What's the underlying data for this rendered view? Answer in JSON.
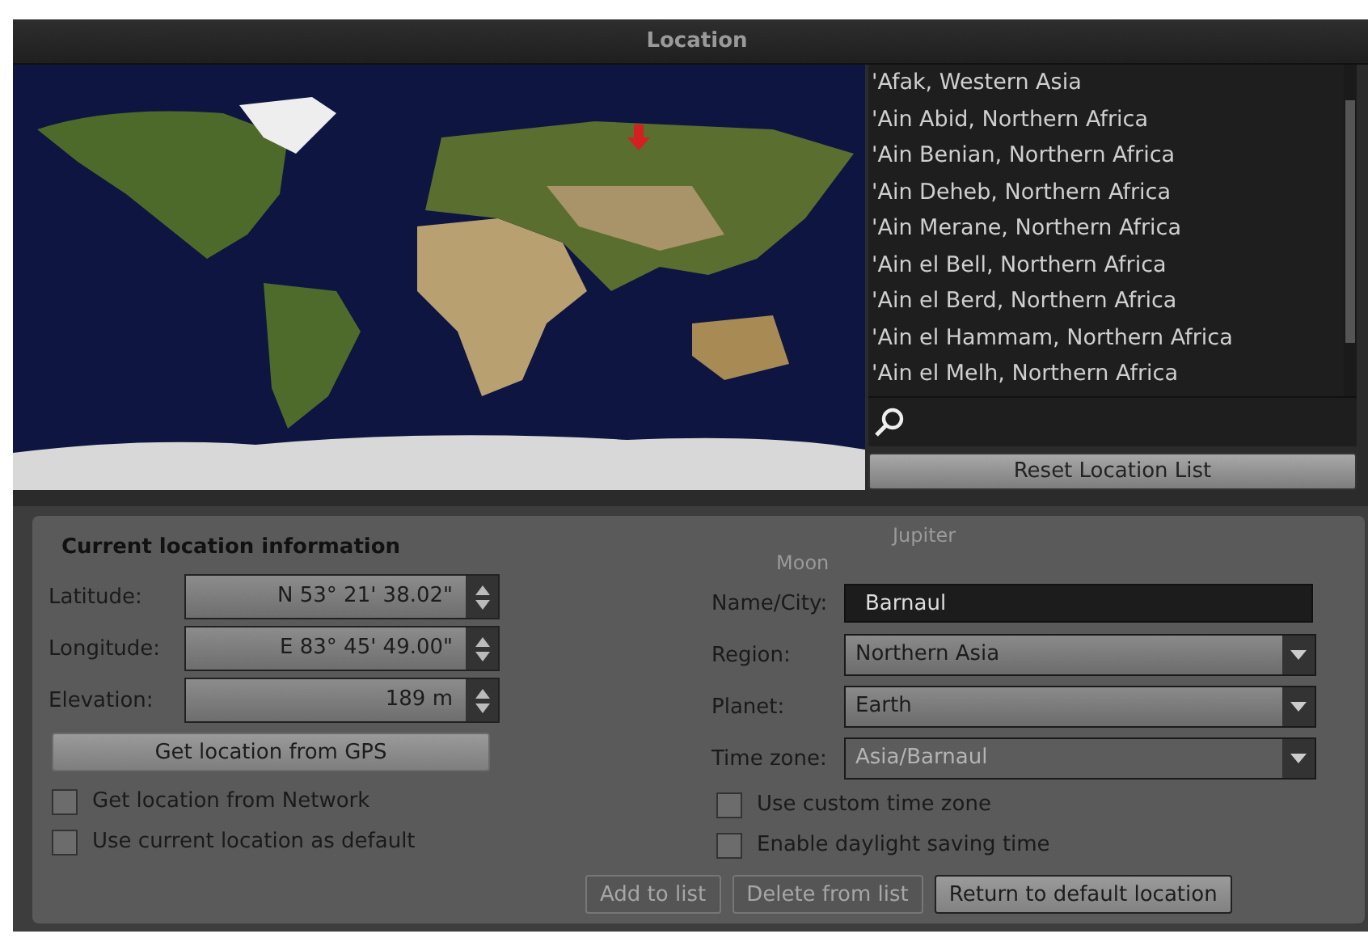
{
  "window": {
    "title": "Location"
  },
  "location_list": {
    "items": [
      "'Afak, Western Asia",
      "'Ain Abid, Northern Africa",
      "'Ain Benian, Northern Africa",
      "'Ain Deheb, Northern Africa",
      "'Ain Merane, Northern Africa",
      "'Ain el Bell, Northern Africa",
      "'Ain el Berd, Northern Africa",
      "'Ain el Hammam, Northern Africa",
      "'Ain el Melh, Northern Africa"
    ]
  },
  "reset_button": "Reset Location List",
  "sky_labels": [
    "Moon",
    "Jupiter"
  ],
  "current": {
    "heading": "Current location information",
    "spin_fields": [
      {
        "label": "Latitude:",
        "value": "N 53° 21' 38.02\""
      },
      {
        "label": "Longitude:",
        "value": "E 83° 45' 49.00\""
      },
      {
        "label": "Elevation:",
        "value": "189 m"
      }
    ],
    "gps_button": "Get location from GPS",
    "checkboxes": [
      {
        "label": "Get location from Network",
        "checked": false
      },
      {
        "label": "Use current location as default",
        "checked": false
      }
    ]
  },
  "details": {
    "name_city": {
      "label": "Name/City:",
      "value": "Barnaul"
    },
    "dropdowns": [
      {
        "label": "Region:",
        "value": "Northern Asia",
        "disabled": false
      },
      {
        "label": "Planet:",
        "value": "Earth",
        "disabled": false
      },
      {
        "label": "Time zone:",
        "value": "Asia/Barnaul",
        "disabled": true
      }
    ],
    "checkboxes": [
      {
        "label": "Use custom time zone",
        "checked": false
      },
      {
        "label": "Enable daylight saving time",
        "checked": false
      }
    ],
    "buttons": [
      {
        "label": "Add to list",
        "disabled": true
      },
      {
        "label": "Delete from list",
        "disabled": true
      },
      {
        "label": "Return to default location",
        "disabled": false
      }
    ]
  }
}
